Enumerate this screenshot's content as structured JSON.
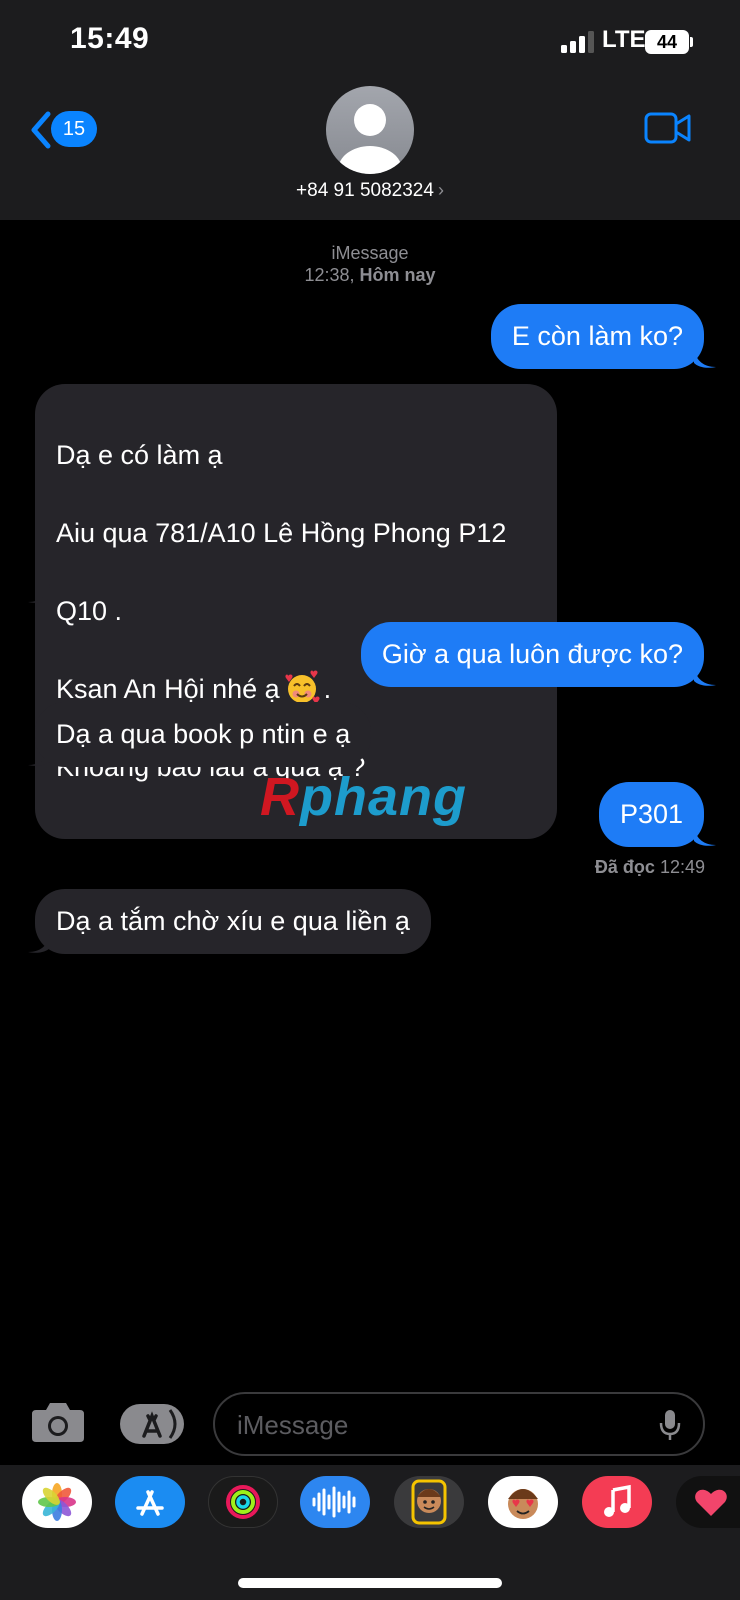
{
  "status_bar": {
    "time": "15:49",
    "network": "LTE",
    "battery": "44"
  },
  "header": {
    "back_count": "15",
    "contact": "+84 91 5082324",
    "contact_chevron": "›"
  },
  "thread": {
    "service": "iMessage",
    "time": "12:38,",
    "day": "Hôm nay"
  },
  "messages": [
    {
      "direction": "out",
      "text": "E còn làm ko?"
    },
    {
      "direction": "in",
      "line1": "Dạ e có làm ạ",
      "line2": "Aiu qua 781/A10 Lê Hồng Phong P12",
      "line3": "Q10 .",
      "line4_before": "Ksan An Hội nhé ạ",
      "line4_after": ".",
      "line5": "Khoảng bao lâu a qua ạ ?",
      "emoji": "smiling-face-with-hearts"
    },
    {
      "direction": "out",
      "text": "Giờ a qua luôn được ko?"
    },
    {
      "direction": "in",
      "text": "Dạ a qua book p ntin e ạ"
    },
    {
      "direction": "out",
      "text": "P301"
    },
    {
      "direction": "in",
      "text": "Dạ a tắm chờ xíu e qua liền ạ"
    }
  ],
  "read_receipt": {
    "label": "Đã đọc",
    "time": "12:49"
  },
  "watermark": {
    "first": "R",
    "rest": "phang"
  },
  "composer": {
    "placeholder": "iMessage"
  },
  "app_drawer": [
    "photos-app",
    "app-store-app",
    "fitness-app",
    "audio-message-app",
    "memoji-app",
    "memoji-stickers-app",
    "music-app",
    "heart-app"
  ],
  "colors": {
    "accent": "#0a84ff",
    "outgoing_bubble": "#1e7cf6",
    "incoming_bubble": "#26252a",
    "header_bg": "#1c1c1e"
  }
}
